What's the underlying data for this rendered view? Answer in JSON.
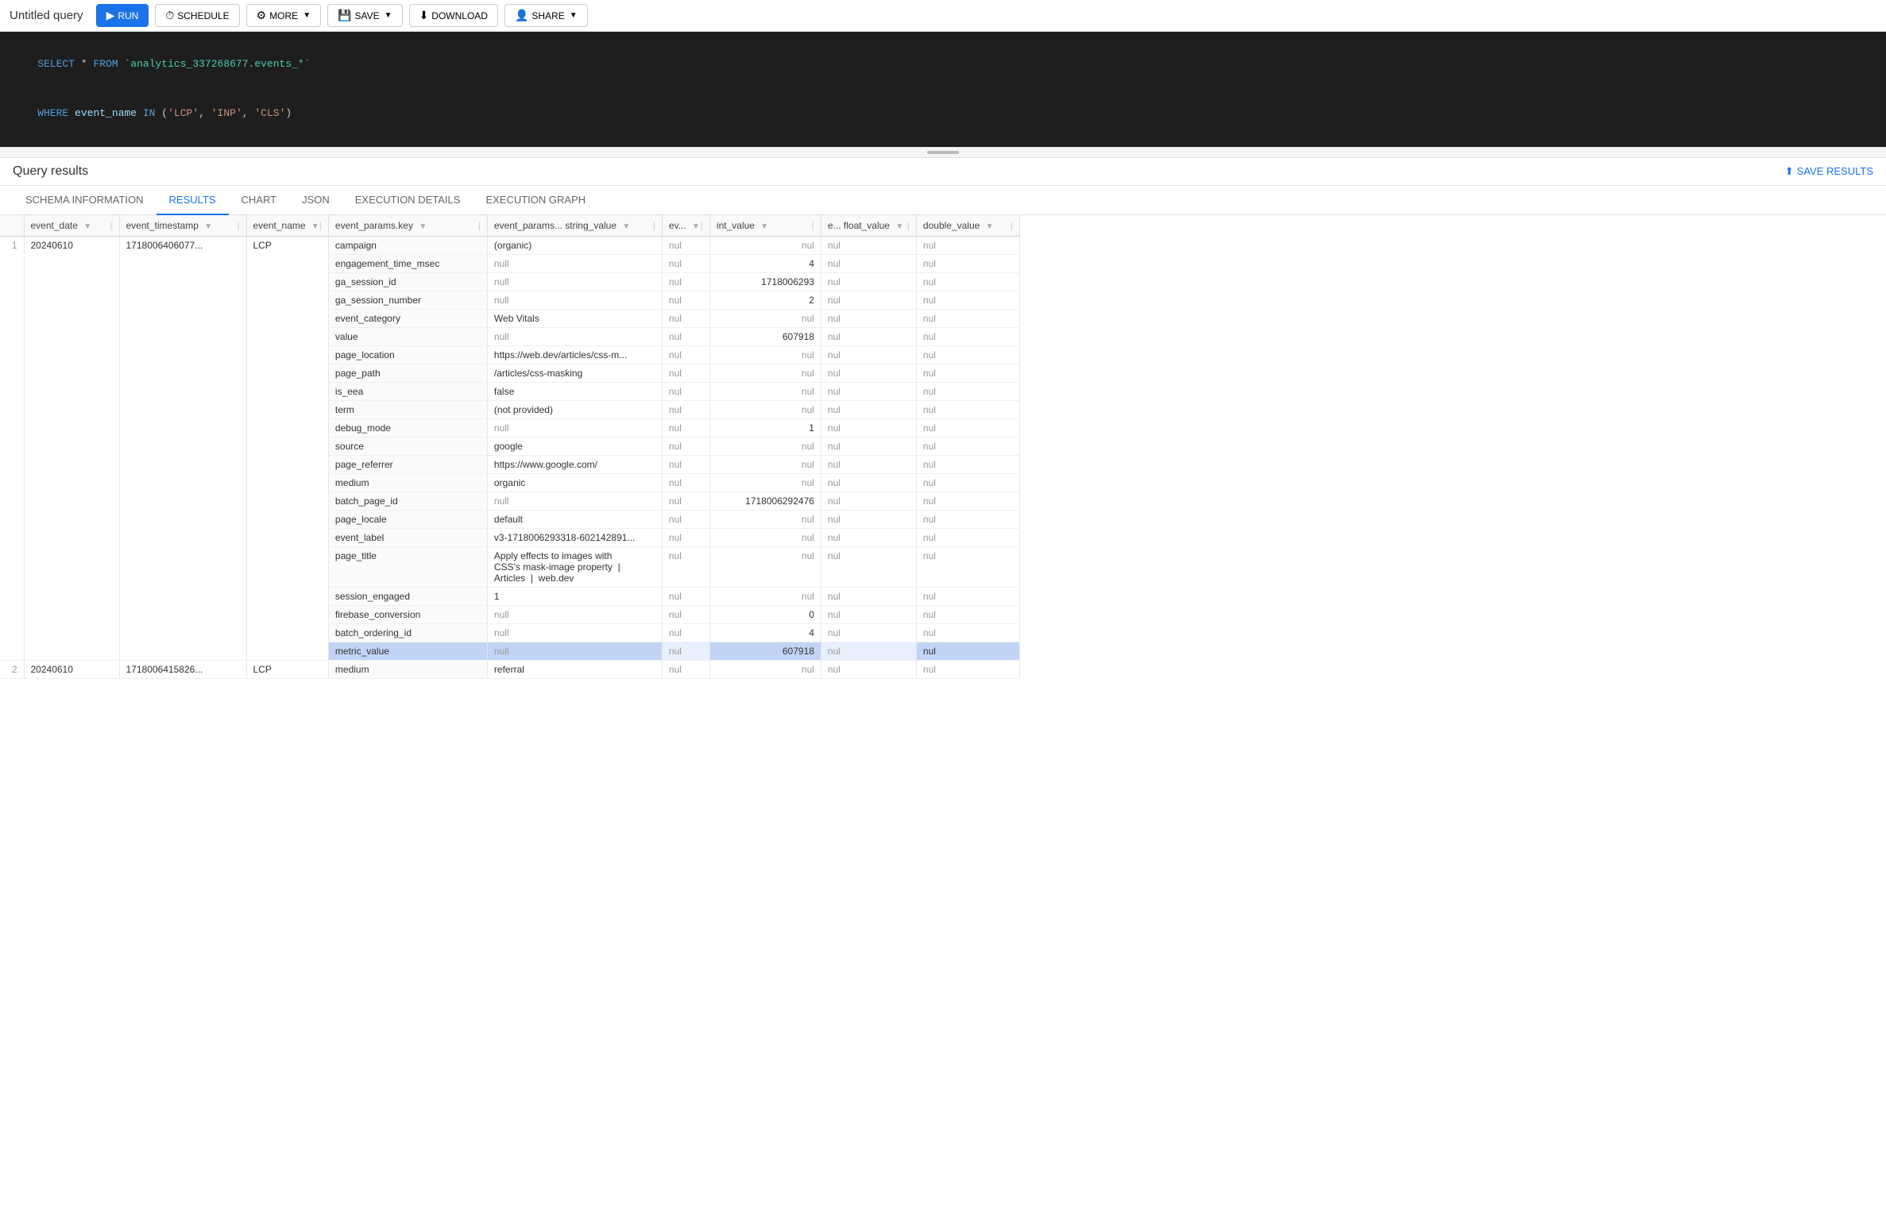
{
  "toolbar": {
    "title": "Untitled query",
    "run_label": "RUN",
    "schedule_label": "SCHEDULE",
    "more_label": "MORE",
    "save_label": "SAVE",
    "download_label": "DOWNLOAD",
    "share_label": "SHARE"
  },
  "sql": {
    "line1": "SELECT * FROM `analytics_337268677.events_*`",
    "line2": "WHERE event_name IN ('LCP', 'INP', 'CLS')"
  },
  "results": {
    "title": "Query results",
    "save_results_label": "SAVE RESULTS"
  },
  "tabs": [
    {
      "id": "schema",
      "label": "SCHEMA INFORMATION"
    },
    {
      "id": "results",
      "label": "RESULTS",
      "active": true
    },
    {
      "id": "chart",
      "label": "CHART"
    },
    {
      "id": "json",
      "label": "JSON"
    },
    {
      "id": "execution_details",
      "label": "EXECUTION DETAILS"
    },
    {
      "id": "execution_graph",
      "label": "EXECUTION GRAPH"
    }
  ],
  "columns": [
    {
      "id": "rownum",
      "label": ""
    },
    {
      "id": "event_date",
      "label": "event_date"
    },
    {
      "id": "event_timestamp",
      "label": "event_timestamp"
    },
    {
      "id": "event_name",
      "label": "event_name"
    },
    {
      "id": "params_key",
      "label": "event_params.key"
    },
    {
      "id": "params_string",
      "label": "event_params... string_value"
    },
    {
      "id": "params_ev",
      "label": "ev..."
    },
    {
      "id": "params_int",
      "label": "int_value"
    },
    {
      "id": "params_efloat",
      "label": "e... float_value"
    },
    {
      "id": "params_double",
      "label": "double_value"
    }
  ],
  "rows": [
    {
      "rownum": "1",
      "event_date": "20240610",
      "event_timestamp": "1718006406077...",
      "event_name": "LCP",
      "params": [
        {
          "key": "campaign",
          "string_value": "(organic)",
          "ev": "",
          "int_value": "",
          "efloat": "",
          "double": ""
        },
        {
          "key": "engagement_time_msec",
          "string_value": "null",
          "ev": "",
          "int_value": "4",
          "efloat": "",
          "double": ""
        },
        {
          "key": "ga_session_id",
          "string_value": "null",
          "ev": "",
          "int_value": "1718006293",
          "efloat": "",
          "double": ""
        },
        {
          "key": "ga_session_number",
          "string_value": "null",
          "ev": "",
          "int_value": "2",
          "efloat": "",
          "double": ""
        },
        {
          "key": "event_category",
          "string_value": "Web Vitals",
          "ev": "",
          "int_value": "",
          "efloat": "",
          "double": ""
        },
        {
          "key": "value",
          "string_value": "null",
          "ev": "",
          "int_value": "607918",
          "efloat": "",
          "double": ""
        },
        {
          "key": "page_location",
          "string_value": "https://web.dev/articles/css-m...",
          "ev": "",
          "int_value": "",
          "efloat": "",
          "double": ""
        },
        {
          "key": "page_path",
          "string_value": "/articles/css-masking",
          "ev": "",
          "int_value": "",
          "efloat": "",
          "double": ""
        },
        {
          "key": "is_eea",
          "string_value": "false",
          "ev": "",
          "int_value": "",
          "efloat": "",
          "double": ""
        },
        {
          "key": "term",
          "string_value": "(not provided)",
          "ev": "",
          "int_value": "",
          "efloat": "",
          "double": ""
        },
        {
          "key": "debug_mode",
          "string_value": "null",
          "ev": "",
          "int_value": "1",
          "efloat": "",
          "double": ""
        },
        {
          "key": "source",
          "string_value": "google",
          "ev": "",
          "int_value": "",
          "efloat": "",
          "double": ""
        },
        {
          "key": "page_referrer",
          "string_value": "https://www.google.com/",
          "ev": "",
          "int_value": "",
          "efloat": "",
          "double": ""
        },
        {
          "key": "medium",
          "string_value": "organic",
          "ev": "",
          "int_value": "",
          "efloat": "",
          "double": ""
        },
        {
          "key": "batch_page_id",
          "string_value": "null",
          "ev": "",
          "int_value": "1718006292476",
          "efloat": "",
          "double": ""
        },
        {
          "key": "page_locale",
          "string_value": "default",
          "ev": "",
          "int_value": "",
          "efloat": "",
          "double": ""
        },
        {
          "key": "event_label",
          "string_value": "v3-1718006293318-602142891...",
          "ev": "",
          "int_value": "",
          "efloat": "",
          "double": ""
        },
        {
          "key": "page_title",
          "string_value": "Apply effects to images with\nCSS's mask-image property  |\nArticles  |  web.dev",
          "ev": "",
          "int_value": "",
          "efloat": "",
          "double": ""
        },
        {
          "key": "session_engaged",
          "string_value": "1",
          "ev": "",
          "int_value": "",
          "efloat": "",
          "double": ""
        },
        {
          "key": "firebase_conversion",
          "string_value": "null",
          "ev": "",
          "int_value": "0",
          "efloat": "",
          "double": ""
        },
        {
          "key": "batch_ordering_id",
          "string_value": "null",
          "ev": "",
          "int_value": "4",
          "efloat": "",
          "double": ""
        },
        {
          "key": "metric_value",
          "string_value": "null",
          "ev": "",
          "int_value": "607918",
          "efloat": "",
          "double": "null",
          "highlight": true
        }
      ]
    },
    {
      "rownum": "2",
      "event_date": "20240610",
      "event_timestamp": "1718006415826...",
      "event_name": "LCP",
      "params": [
        {
          "key": "medium",
          "string_value": "referral",
          "ev": "",
          "int_value": "",
          "efloat": "",
          "double": ""
        }
      ]
    }
  ],
  "null_text": "null",
  "null_display": "nul"
}
